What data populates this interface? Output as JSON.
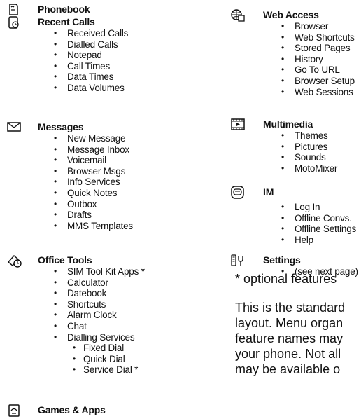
{
  "left": {
    "phonebook": {
      "title": "Phonebook",
      "icon": "phonebook-icon"
    },
    "recent_calls": {
      "title": "Recent Calls",
      "icon": "recent-calls-icon",
      "items": [
        "Received Calls",
        "Dialled Calls",
        "Notepad",
        "Call Times",
        "Data Times",
        "Data Volumes"
      ]
    },
    "messages": {
      "title": "Messages",
      "icon": "envelope-icon",
      "items": [
        "New Message",
        "Message Inbox",
        "Voicemail",
        "Browser Msgs",
        "Info Services",
        "Quick Notes",
        "Outbox",
        "Drafts",
        "MMS Templates"
      ]
    },
    "office_tools": {
      "title": "Office Tools",
      "icon": "office-tools-icon",
      "items": [
        "SIM Tool Kit Apps *",
        "Calculator",
        "Datebook",
        "Shortcuts",
        "Alarm Clock",
        "Chat",
        "Dialling Services"
      ],
      "subitems": [
        "Fixed Dial",
        "Quick Dial",
        "Service Dial *"
      ]
    },
    "games": {
      "title": "Games & Apps",
      "icon": "games-icon"
    }
  },
  "right": {
    "web_access": {
      "title": "Web Access",
      "icon": "globe-icon",
      "items": [
        "Browser",
        "Web Shortcuts",
        "Stored Pages",
        "History",
        "Go To URL",
        "Browser Setup",
        "Web Sessions"
      ]
    },
    "multimedia": {
      "title": "Multimedia",
      "icon": "film-icon",
      "items": [
        "Themes",
        "Pictures",
        "Sounds",
        "MotoMixer"
      ]
    },
    "im": {
      "title": "IM",
      "icon": "im-icon",
      "items": [
        "Log In",
        "Offline Convs.",
        "Offline Settings",
        "Help"
      ]
    },
    "settings": {
      "title": "Settings",
      "icon": "settings-icon",
      "items": [
        "(see next page)"
      ]
    }
  },
  "notes": {
    "optional": "* optional features",
    "description_lines": [
      "This is the standard",
      "layout. Menu organ",
      "feature names may",
      "your phone. Not all",
      "may be available o"
    ]
  }
}
